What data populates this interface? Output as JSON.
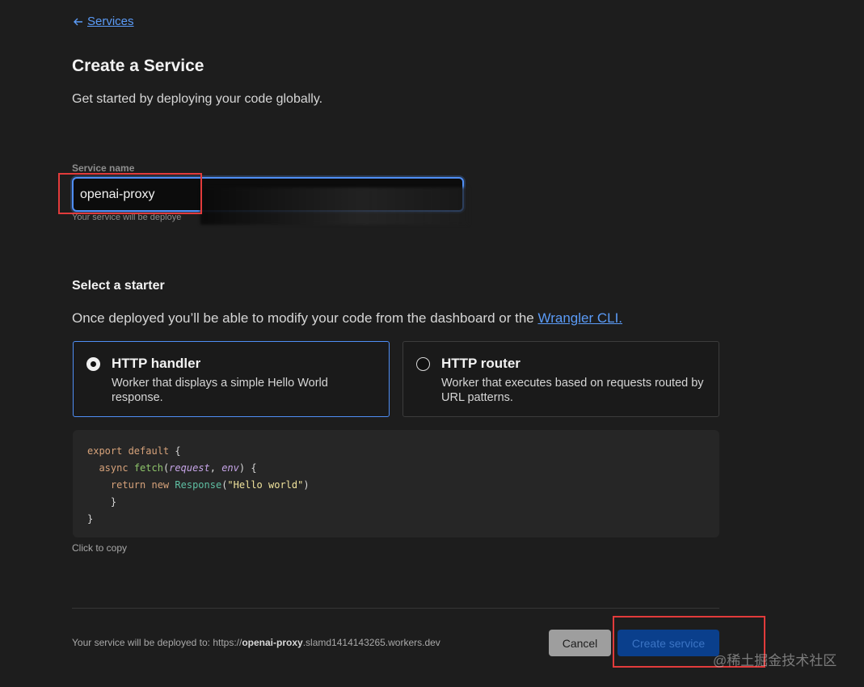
{
  "nav": {
    "back_label": "Services"
  },
  "header": {
    "title": "Create a Service",
    "subtitle": "Get started by deploying your code globally."
  },
  "service_name": {
    "label": "Service name",
    "value": "openai-proxy",
    "hint": "Your service will be deploye"
  },
  "starter": {
    "title": "Select a starter",
    "desc_prefix": "Once deployed you’ll be able to modify your code from the dashboard or the ",
    "desc_link": "Wrangler CLI.",
    "options": [
      {
        "title": "HTTP handler",
        "desc": "Worker that displays a simple Hello World response.",
        "selected": true
      },
      {
        "title": "HTTP router",
        "desc": "Worker that executes based on requests routed by URL patterns.",
        "selected": false
      }
    ]
  },
  "code": {
    "line1_kw": "export default",
    "line1_punc": " {",
    "line2_kw": "async",
    "line2_fn": "fetch",
    "line2_p1": "request",
    "line2_p2": "env",
    "line3_kw": "return new",
    "line3_cls": "Response",
    "line3_str": "\"Hello world\"",
    "copy_hint": "Click to copy"
  },
  "footer": {
    "prefix": "Your service will be deployed to: https://",
    "bold": "openai-proxy",
    "suffix": ".slamd1414143265.workers.dev",
    "cancel_label": "Cancel",
    "create_label": "Create service"
  },
  "watermark": "@稀土掘金技术社区",
  "colors": {
    "accent": "#4f8ef5",
    "highlight": "#e23b3b",
    "background": "#1d1d1d"
  }
}
